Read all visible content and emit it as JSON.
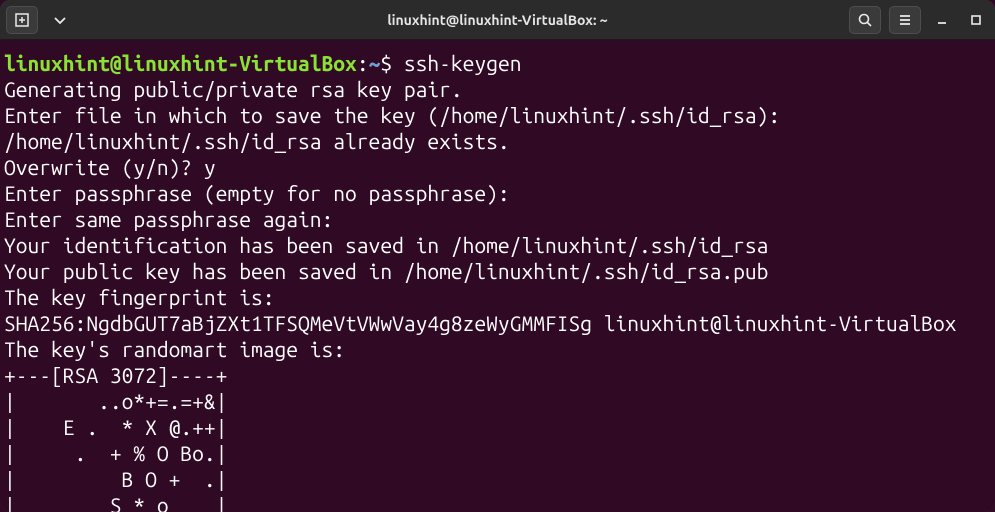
{
  "window": {
    "title": "linuxhint@linuxhint-VirtualBox: ~"
  },
  "prompt": {
    "user": "linuxhint",
    "at": "@",
    "host": "linuxhint-VirtualBox",
    "colon": ":",
    "path": "~",
    "dollar": "$",
    "command": " ssh-keygen"
  },
  "output": {
    "l1": "Generating public/private rsa key pair.",
    "l2": "Enter file in which to save the key (/home/linuxhint/.ssh/id_rsa):",
    "l3": "/home/linuxhint/.ssh/id_rsa already exists.",
    "l4": "Overwrite (y/n)? y",
    "l5": "Enter passphrase (empty for no passphrase):",
    "l6": "Enter same passphrase again:",
    "l7": "Your identification has been saved in /home/linuxhint/.ssh/id_rsa",
    "l8": "Your public key has been saved in /home/linuxhint/.ssh/id_rsa.pub",
    "l9": "The key fingerprint is:",
    "l10": "SHA256:NgdbGUT7aBjZXt1TFSQMeVtVWwVay4g8zeWyGMMFISg linuxhint@linuxhint-VirtualBox",
    "l11": "The key's randomart image is:",
    "l12": "+---[RSA 3072]----+",
    "l13": "|       ..o*+=.=+&|",
    "l14": "|    E .  * X @.++|",
    "l15": "|     .  + % O Bo.|",
    "l16": "|         B O +  .|",
    "l17": "|        S * o    |"
  }
}
